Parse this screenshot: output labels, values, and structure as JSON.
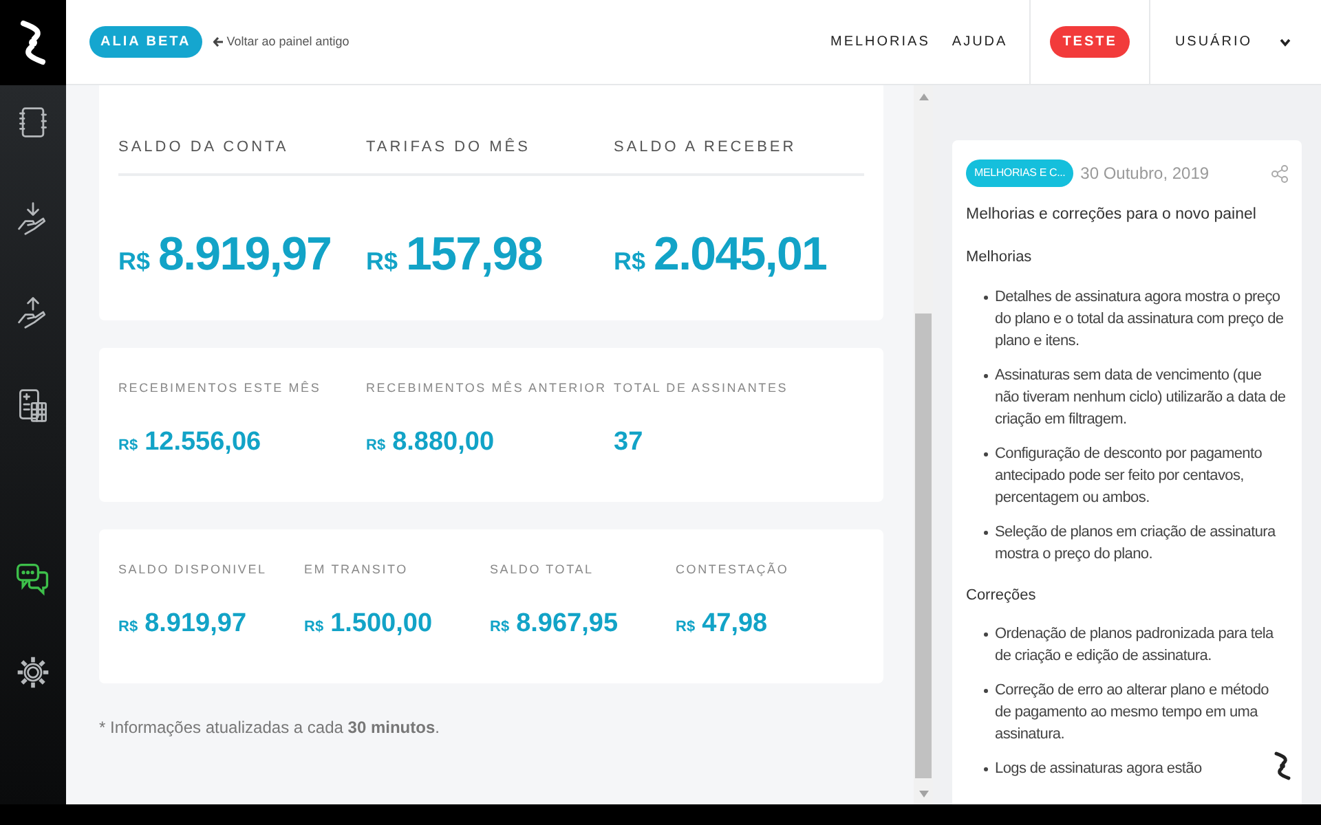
{
  "header": {
    "beta_badge": "ALIA BETA",
    "back_link": "Voltar ao painel antigo",
    "nav": [
      "MELHORIAS",
      "AJUDA"
    ],
    "env_badge": "TESTE",
    "user_menu": "USUÁRIO"
  },
  "sidebar": {
    "items": [
      {
        "kind": "invoice"
      },
      {
        "kind": "receive"
      },
      {
        "kind": "send"
      },
      {
        "kind": "calculator"
      },
      {
        "kind": "chat"
      },
      {
        "kind": "settings"
      }
    ]
  },
  "balances": [
    {
      "label": "SALDO DA CONTA",
      "currency": "R$",
      "value": "8.919,97"
    },
    {
      "label": "TARIFAS DO MÊS",
      "currency": "R$",
      "value": "157,98"
    },
    {
      "label": "SALDO A RECEBER",
      "currency": "R$",
      "value": "2.045,01"
    }
  ],
  "receipts": [
    {
      "label": "RECEBIMENTOS ESTE MÊS",
      "currency": "R$",
      "value": "12.556,06"
    },
    {
      "label": "RECEBIMENTOS MÊS ANTERIOR",
      "currency": "R$",
      "value": "8.880,00"
    },
    {
      "label": "TOTAL DE ASSINANTES",
      "value": "37"
    }
  ],
  "totals": [
    {
      "label": "SALDO DISPONIVEL",
      "currency": "R$",
      "value": "8.919,97"
    },
    {
      "label": "EM TRANSITO",
      "currency": "R$",
      "value": "1.500,00"
    },
    {
      "label": "SALDO TOTAL",
      "currency": "R$",
      "value": "8.967,95"
    },
    {
      "label": "CONTESTAÇÃO",
      "currency": "R$",
      "value": "47,98"
    }
  ],
  "footnote": "* Informações atualizadas a cada **30 minutos**.",
  "news": {
    "tag": "MELHORIAS E C...",
    "date": "30 Outubro, 2019",
    "title": "Melhorias e correções para o novo painel",
    "sections": [
      {
        "heading": "Melhorias",
        "items": [
          "Detalhes de assinatura agora mostra o preço do plano e o total da assinatura com preço de plano e itens.",
          "Assinaturas sem data de vencimento (que não tiveram nenhum ciclo) utilizarão a data de criação em filtragem.",
          "Configuração de desconto por pagamento antecipado pode ser feito por centavos, percentagem ou ambos.",
          "Seleção de planos em criação de assinatura mostra o preço do plano."
        ]
      },
      {
        "heading": "Correções",
        "items": [
          "Ordenação de planos padronizada para tela de criação e edição de assinatura.",
          "Correção de erro ao alterar plano e método de pagamento ao mesmo tempo em uma assinatura.",
          "Logs de assinaturas agora estão"
        ]
      }
    ]
  }
}
